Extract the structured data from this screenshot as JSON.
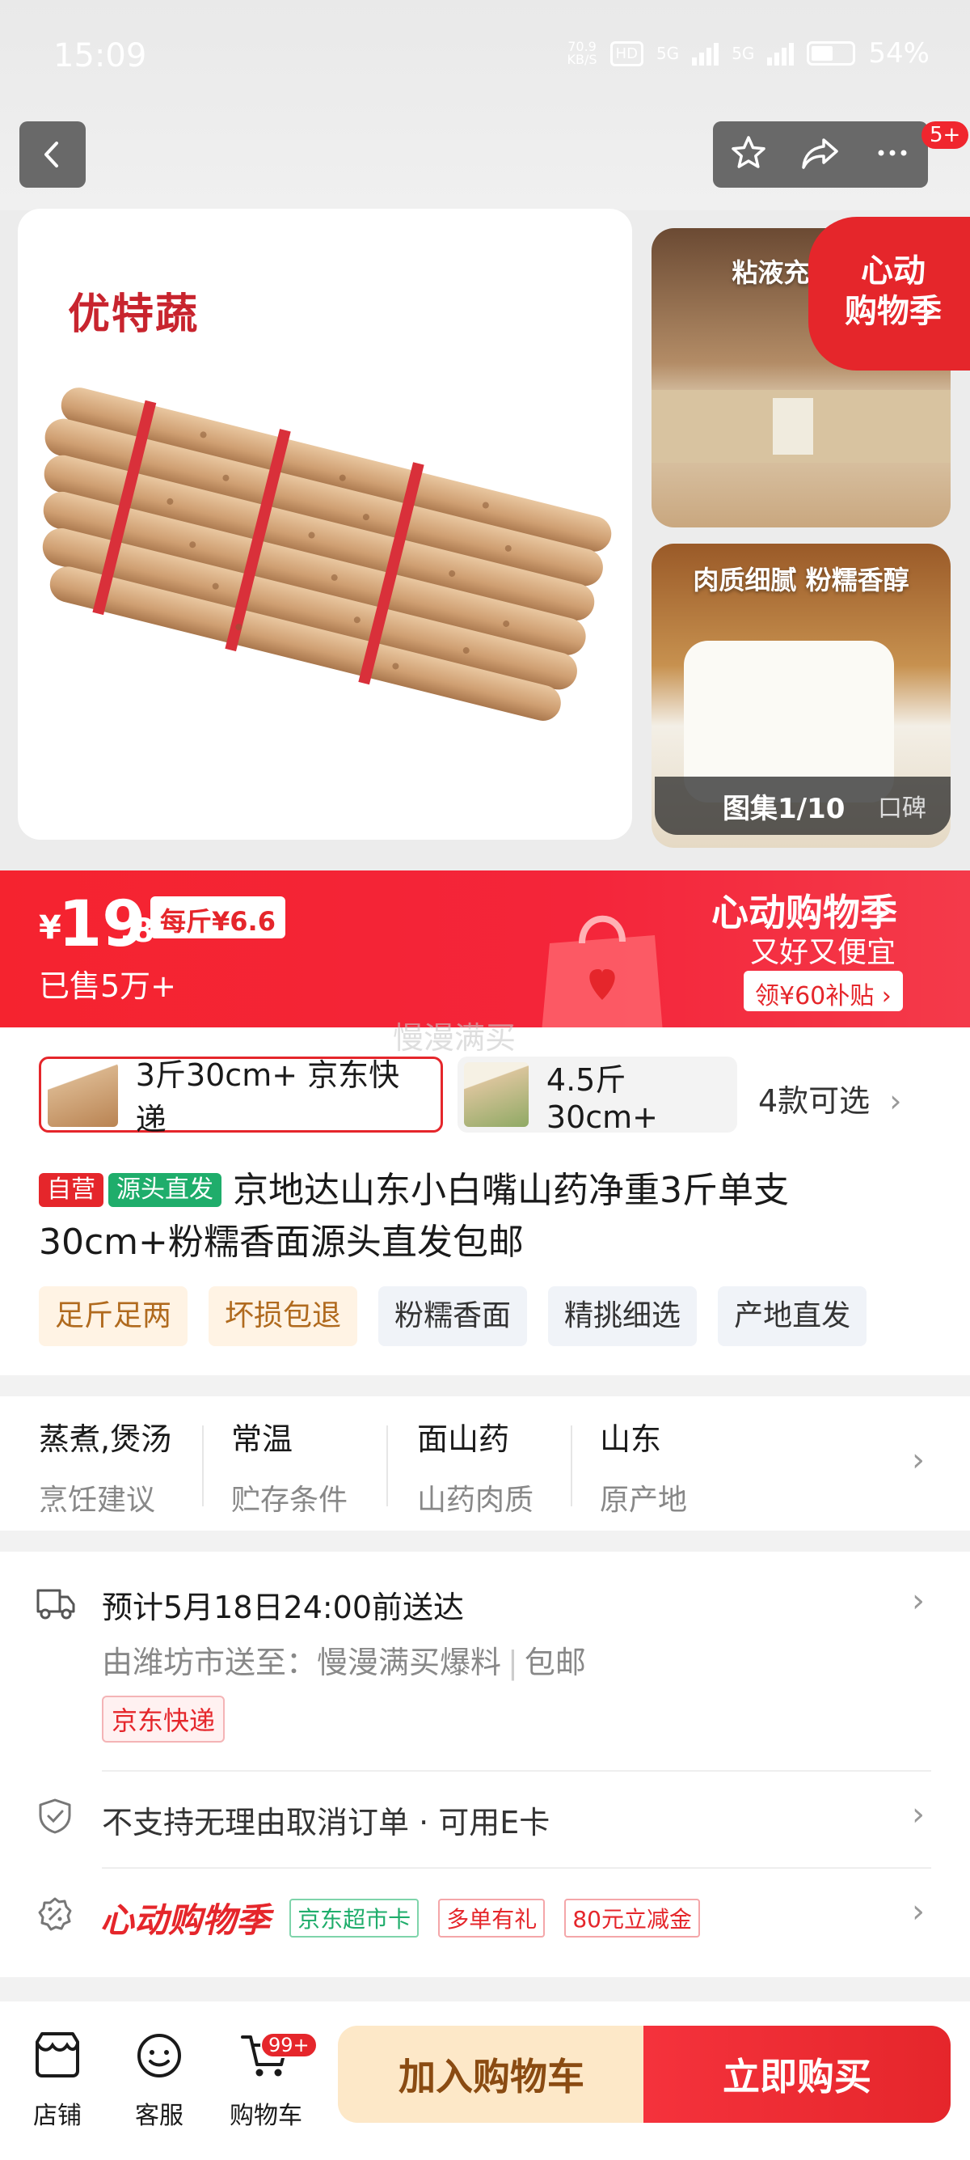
{
  "status_bar": {
    "time": "15:09",
    "net_speed_value": "70.9",
    "net_speed_unit": "KB/S",
    "hd": "HD",
    "sim1": "5G",
    "sim2": "5G",
    "battery_percent": "54%",
    "battery_level": 0.54
  },
  "top_actions": {
    "back_icon": "chevron-left-icon",
    "favorite_icon": "star-icon",
    "share_icon": "share-icon",
    "more_icon": "more-icon",
    "message_badge": "5+"
  },
  "gallery": {
    "brand_text": "优特蔬",
    "side_image_1_caption": "粘液充足 营",
    "side_image_2_caption": "肉质细腻 粉糯香醇",
    "promo_tag_line1": "心动",
    "promo_tag_line2": "购物季",
    "counter": "图集1/10",
    "review_tab": "口碑"
  },
  "price_banner": {
    "currency": "¥",
    "price_int": "19",
    "price_dec": ".8",
    "per_jin": "每斤¥6.6",
    "sold": "已售5万+",
    "festival_title": "心动购物季",
    "festival_sub": "又好又便宜",
    "coupon": "领¥60补贴 ›",
    "colors": {
      "red": "#f5232f"
    }
  },
  "watermark": "慢漫满买",
  "sku": {
    "options": [
      {
        "label": "3斤30cm+ 京东快递",
        "selected": true
      },
      {
        "label": "4.5斤30cm+",
        "selected": false
      }
    ],
    "more": "4款可选"
  },
  "product": {
    "tag_self": "自营",
    "tag_source": "源头直发",
    "title_line1": "京地达山东小白嘴山药净重3斤单支",
    "title_line2": "30cm+粉糯香面源头直发包邮",
    "features": [
      "足斤足两",
      "坏损包退",
      "粉糯香面",
      "精挑细选",
      "产地直发"
    ]
  },
  "specs": [
    {
      "value": "蒸煮,煲汤",
      "key": "烹饪建议"
    },
    {
      "value": "常温",
      "key": "贮存条件"
    },
    {
      "value": "面山药",
      "key": "山药肉质"
    },
    {
      "value": "山东",
      "key": "原产地"
    }
  ],
  "delivery": {
    "icon": "truck-icon",
    "eta": "预计5月18日24:00前送达",
    "route": "由潍坊市送至：慢漫满买爆料",
    "shipping": "包邮",
    "carrier": "京东快递"
  },
  "service": {
    "icon": "shield-check-icon",
    "text": "不支持无理由取消订单 · 可用E卡"
  },
  "promotion": {
    "icon": "discount-icon",
    "title": "心动购物季",
    "pills": [
      "京东超市卡",
      "多单有礼",
      "80元立减金"
    ]
  },
  "bottom_bar": {
    "store": "店铺",
    "service": "客服",
    "cart": "购物车",
    "cart_badge": "99+",
    "add_to_cart": "加入购物车",
    "buy_now": "立即购买"
  }
}
